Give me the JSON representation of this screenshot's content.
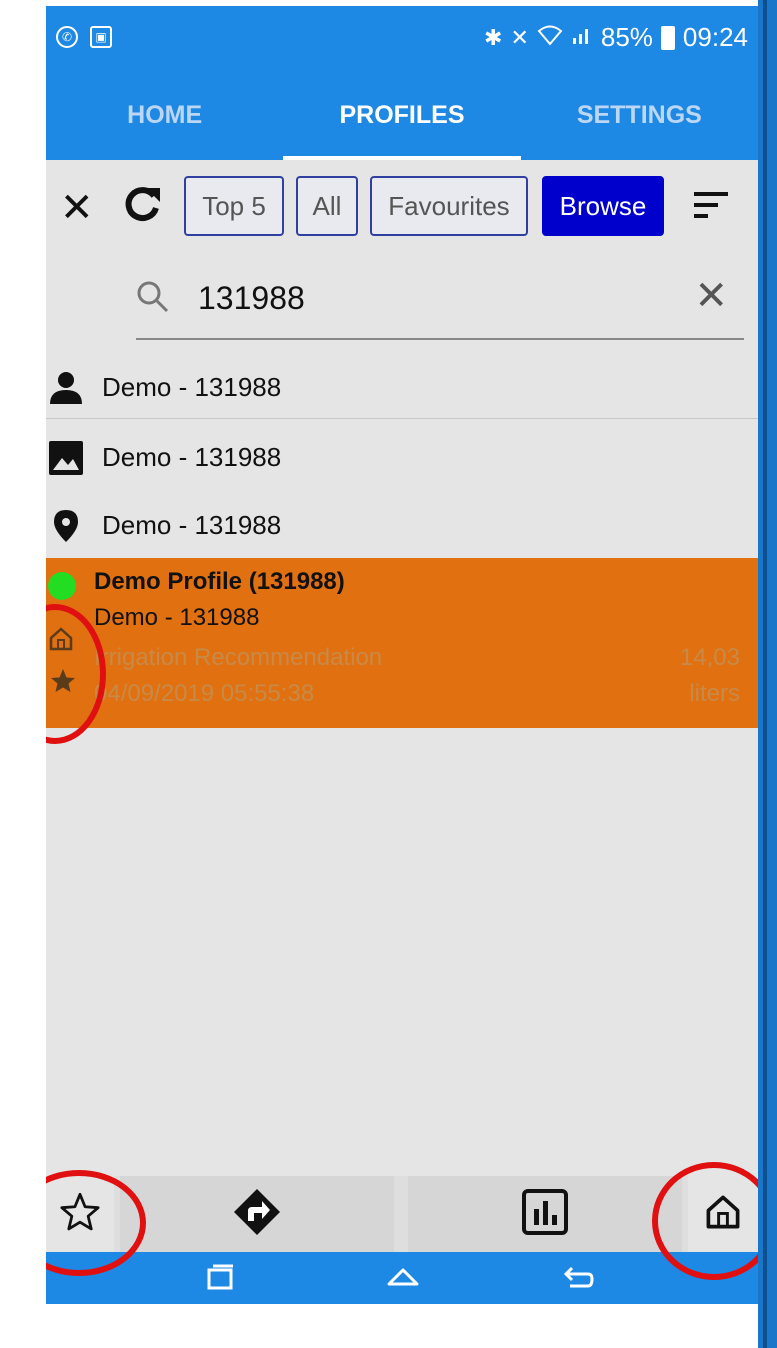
{
  "status_bar": {
    "battery": "85%",
    "time": "09:24",
    "left_icons": [
      "whatsapp-icon",
      "gallery-icon"
    ],
    "right_icons": [
      "bluetooth-icon",
      "mute-icon",
      "wifi-icon",
      "signal-icon"
    ]
  },
  "tabs": [
    {
      "label": "HOME",
      "active": false
    },
    {
      "label": "PROFILES",
      "active": true
    },
    {
      "label": "SETTINGS",
      "active": false
    }
  ],
  "toolbar": {
    "close_icon": "close-icon",
    "refresh_icon": "refresh-icon",
    "filters": [
      {
        "label": "Top 5",
        "active": false
      },
      {
        "label": "All",
        "active": false
      },
      {
        "label": "Favourites",
        "active": false
      },
      {
        "label": "Browse",
        "active": true
      }
    ],
    "sort_icon": "sort-icon"
  },
  "search": {
    "value": "131988",
    "search_icon": "search-icon",
    "clear_icon": "clear-icon"
  },
  "results": [
    {
      "icon": "person-icon",
      "label": "Demo - 131988"
    },
    {
      "icon": "image-icon",
      "label": "Demo - 131988"
    },
    {
      "icon": "location-pin-icon",
      "label": "Demo - 131988"
    }
  ],
  "profile_card": {
    "title": "Demo Profile (131988)",
    "subtitle": "Demo - 131988",
    "recommendation_label": "Irrigation Recommendation",
    "datetime": "04/09/2019 05:55:38",
    "amount": "14,03",
    "unit": "liters",
    "status_color": "#22dd22",
    "background_color": "#e07010"
  },
  "bottom_bar": {
    "buttons": [
      "star-outline-icon",
      "directions-icon",
      "chart-icon",
      "home-icon"
    ]
  },
  "nav_bar": {
    "buttons": [
      "recent-apps-icon",
      "home-nav-icon",
      "back-icon"
    ]
  },
  "colors": {
    "primary": "#1e88e5",
    "browse_active": "#0000cc",
    "annotation": "#e01010"
  }
}
